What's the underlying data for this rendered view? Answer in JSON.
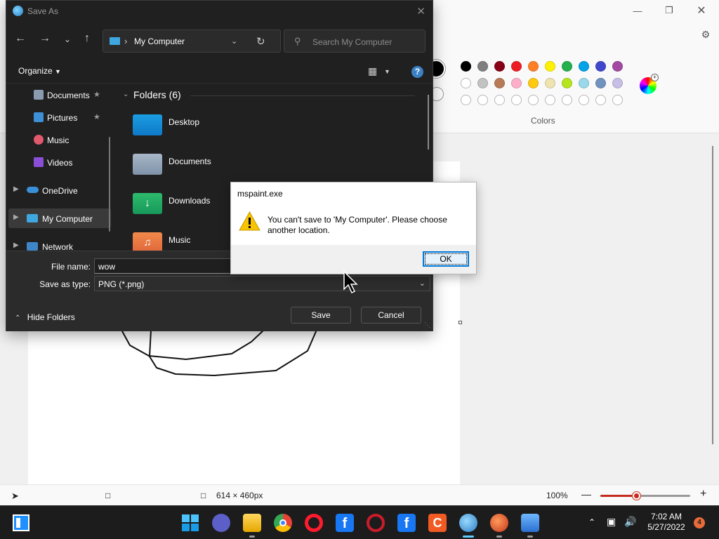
{
  "paint": {
    "colors_label": "Colors",
    "canvas_size": "614 × 460px",
    "zoom": "100%",
    "zoom_fraction": 0.4,
    "palette_row1": [
      "#000000",
      "#7f7f7f",
      "#880015",
      "#ed1c24",
      "#ff7f27",
      "#fff200",
      "#22b14c",
      "#00a2e8",
      "#3f48cc",
      "#a349a4"
    ],
    "palette_row2": [
      "#ffffff",
      "#c3c3c3",
      "#b97a57",
      "#ffaec9",
      "#ffc90e",
      "#efe4b0",
      "#b5e61d",
      "#99d9ea",
      "#7092be",
      "#c8bfe7"
    ],
    "palette_row3_count": 10
  },
  "save_dialog": {
    "title": "Save As",
    "address": "My Computer",
    "search_placeholder": "Search My Computer",
    "organize": "Organize",
    "help": "?",
    "sidebar": [
      {
        "label": "Documents",
        "pinned": true
      },
      {
        "label": "Pictures",
        "pinned": true
      },
      {
        "label": "Music",
        "pinned": false
      },
      {
        "label": "Videos",
        "pinned": false
      },
      {
        "label": "OneDrive",
        "pinned": false
      },
      {
        "label": "My Computer",
        "pinned": false
      },
      {
        "label": "Network",
        "pinned": false
      }
    ],
    "folders_header": "Folders (6)",
    "folders": [
      "Desktop",
      "Documents",
      "Downloads",
      "Music"
    ],
    "file_name_label": "File name:",
    "file_name_value": "wow",
    "save_type_label": "Save as type:",
    "save_type_value": "PNG (*.png)",
    "hide_folders": "Hide Folders",
    "save_button": "Save",
    "cancel_button": "Cancel"
  },
  "message_box": {
    "title": "mspaint.exe",
    "message": "You can't save to 'My Computer'. Please choose another location.",
    "ok_button": "OK"
  },
  "taskbar": {
    "time": "7:02 AM",
    "date": "5/27/2022",
    "notification_count": "4",
    "accent": "#0078d4"
  }
}
